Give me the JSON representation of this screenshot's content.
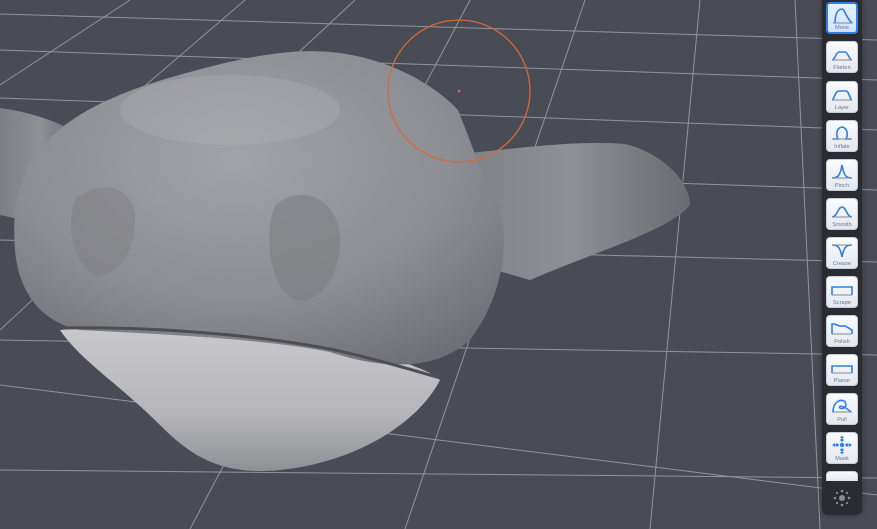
{
  "app": {
    "title": ""
  },
  "viewport": {
    "name": "3d-sculpt-viewport",
    "brush_cursor_color": "#d4693c",
    "background": "#4a4c55",
    "grid_color": "#9a9ca6"
  },
  "toolbar": {
    "accent": "#2f7fe6",
    "tools": [
      {
        "id": "move",
        "label": "Move",
        "icon": "move-brush-icon",
        "active": true
      },
      {
        "id": "flatten",
        "label": "Flatten",
        "icon": "flatten-brush-icon",
        "active": false
      },
      {
        "id": "layer",
        "label": "Layer",
        "icon": "layer-brush-icon",
        "active": false
      },
      {
        "id": "inflate",
        "label": "Inflate",
        "icon": "inflate-brush-icon",
        "active": false
      },
      {
        "id": "pinch",
        "label": "Pinch",
        "icon": "pinch-brush-icon",
        "active": false
      },
      {
        "id": "smooth",
        "label": "Smooth",
        "icon": "smooth-brush-icon",
        "active": false
      },
      {
        "id": "crease",
        "label": "Crease",
        "icon": "crease-brush-icon",
        "active": false
      },
      {
        "id": "scrape",
        "label": "Scrape",
        "icon": "scrape-brush-icon",
        "active": false
      },
      {
        "id": "polish",
        "label": "Polish",
        "icon": "polish-brush-icon",
        "active": false
      },
      {
        "id": "planar",
        "label": "Planar",
        "icon": "planar-brush-icon",
        "active": false
      },
      {
        "id": "pull",
        "label": "Pull",
        "icon": "pull-brush-icon",
        "active": false
      },
      {
        "id": "mask",
        "label": "Mask",
        "icon": "mask-brush-icon",
        "active": false
      }
    ],
    "settings_icon": "settings-icon"
  }
}
